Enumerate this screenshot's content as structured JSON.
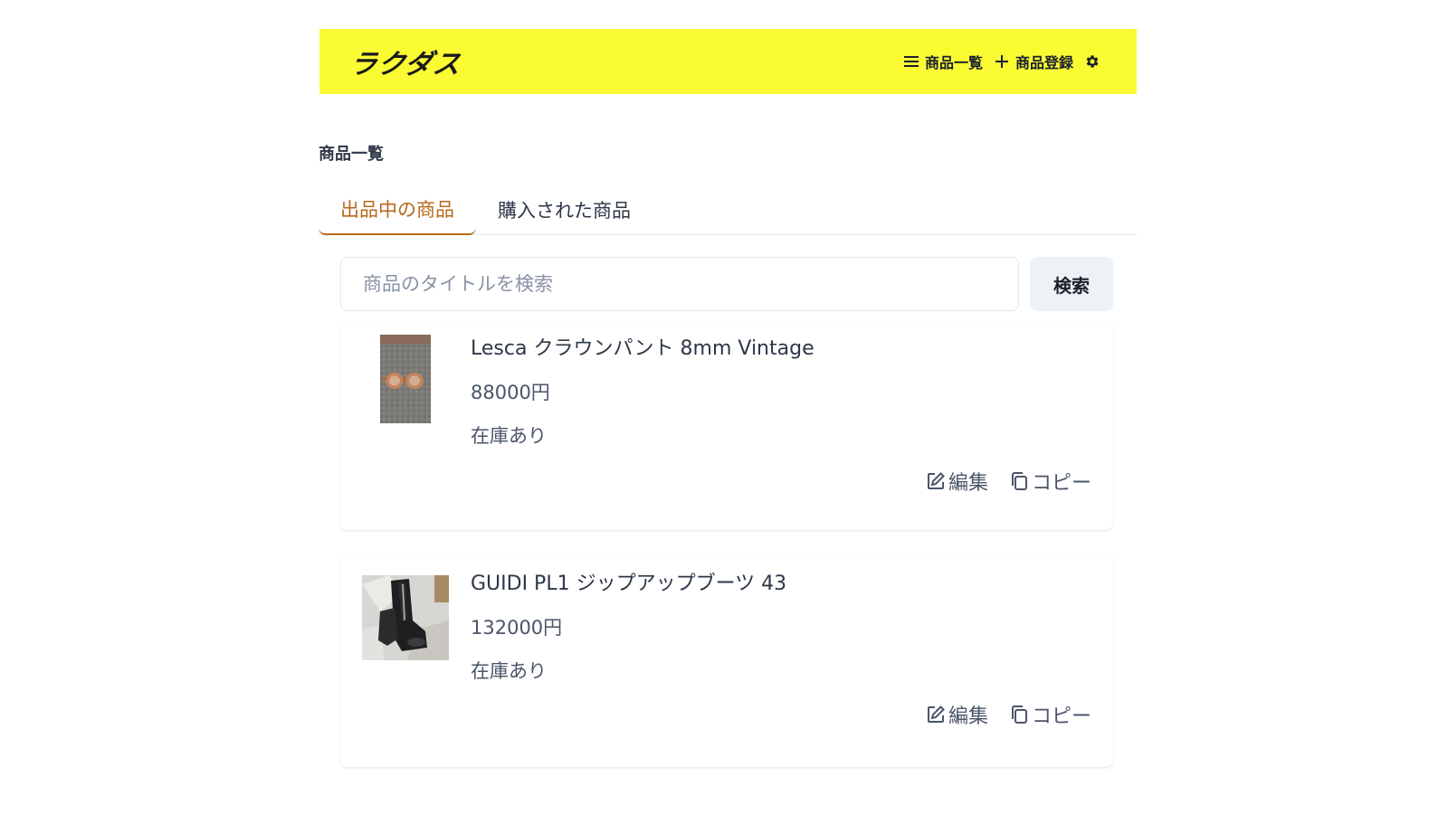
{
  "header": {
    "logo": "ラクダス",
    "nav": {
      "list_label": "商品一覧",
      "register_label": "商品登録"
    },
    "colors": {
      "background": "#fbfb34"
    }
  },
  "page": {
    "title": "商品一覧"
  },
  "tabs": [
    {
      "label": "出品中の商品",
      "active": true
    },
    {
      "label": "購入された商品",
      "active": false
    }
  ],
  "search": {
    "placeholder": "商品のタイトルを検索",
    "value": "",
    "button_label": "検索"
  },
  "products": [
    {
      "name": "Lesca クラウンパント 8mm Vintage",
      "price": "88000円",
      "stock": "在庫あり",
      "image": "sunglasses-photo",
      "edit_label": "編集",
      "copy_label": "コピー"
    },
    {
      "name": "GUIDI PL1 ジップアップブーツ 43",
      "price": "132000円",
      "stock": "在庫あり",
      "image": "boots-photo",
      "edit_label": "編集",
      "copy_label": "コピー"
    }
  ],
  "colors": {
    "accent": "#b7691a"
  }
}
